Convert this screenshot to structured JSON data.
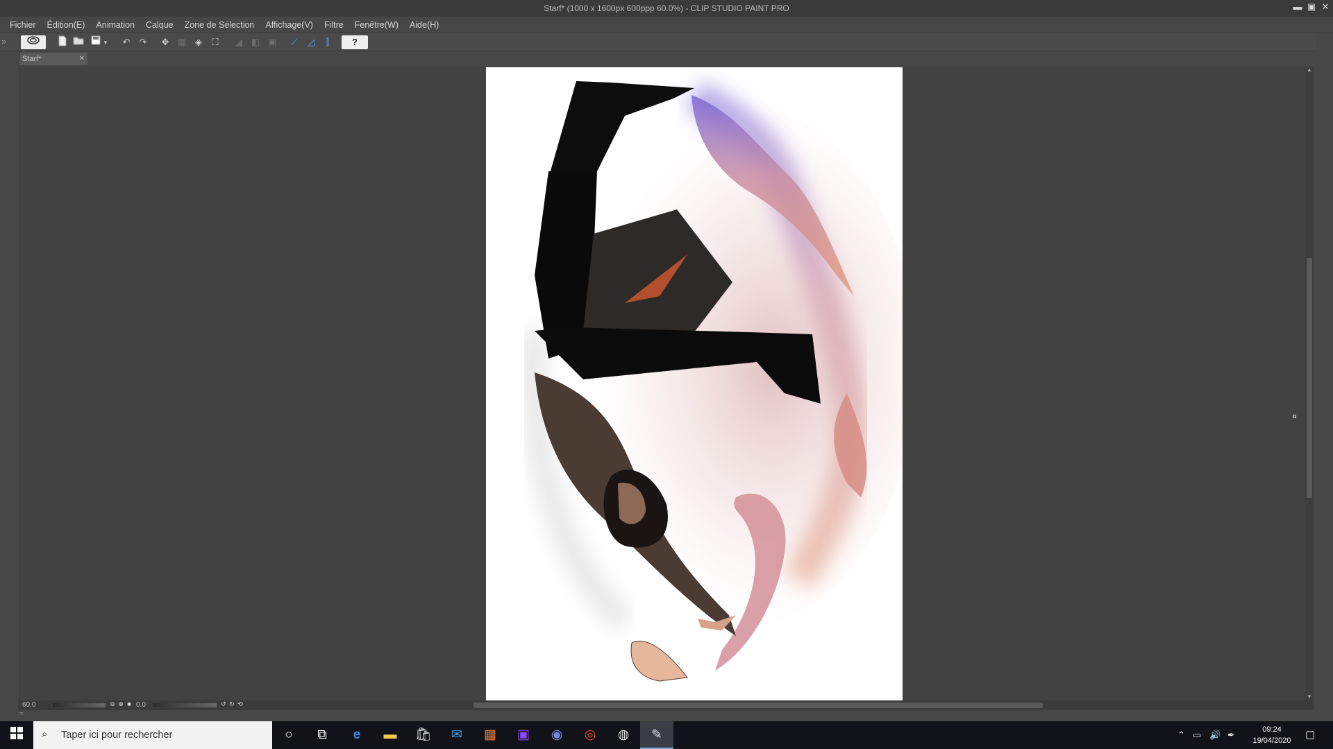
{
  "window": {
    "title": "Starf* (1000 x 1600px 600ppp 60.0%)  - CLIP STUDIO PAINT PRO",
    "buttons": {
      "minimize": "▬",
      "maximize": "▣",
      "close": "✕"
    }
  },
  "menu": [
    "Fichier",
    "Édition(E)",
    "Animation",
    "Calque",
    "Zone de Sélection",
    "Affichage(V)",
    "Filtre",
    "Fenêtre(W)",
    "Aide(H)"
  ],
  "toolbar": {
    "collapse_left": "»",
    "collapse_right": "«",
    "help_label": "?",
    "icons": [
      "clip-studio-logo-icon",
      "new-file-icon",
      "open-file-icon",
      "save-icon",
      "undo-icon",
      "redo-icon",
      "transform-icon",
      "scale-icon",
      "fill-icon",
      "fit-icon",
      "snap-ruler-icon",
      "snap-special-ruler-icon",
      "snap-grid-icon",
      "help-icon"
    ]
  },
  "document": {
    "tab_label": "Starf*",
    "tab_close": "✕"
  },
  "status": {
    "zoom": "60.0",
    "angle": "0.0"
  },
  "taskbar": {
    "search_placeholder": "Taper ici pour rechercher",
    "time": "09:24",
    "date": "19/04/2020",
    "apps": [
      "cortana-icon",
      "task-view-icon",
      "edge-icon",
      "file-explorer-icon",
      "store-icon",
      "mail-icon",
      "photos-icon",
      "twitch-icon",
      "discord-icon",
      "chrome-icon",
      "clip-studio-icon",
      "clip-studio-paint-icon"
    ]
  }
}
